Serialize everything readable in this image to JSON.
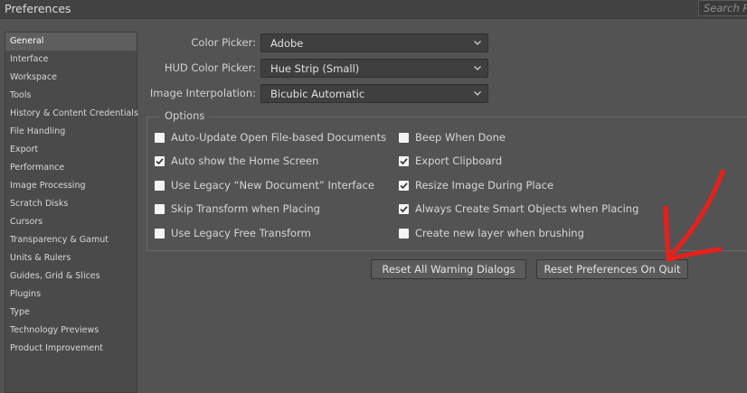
{
  "window": {
    "title": "Preferences"
  },
  "search": {
    "placeholder": "Search P"
  },
  "sidebar": {
    "items": [
      {
        "label": "General",
        "active": true
      },
      {
        "label": "Interface"
      },
      {
        "label": "Workspace"
      },
      {
        "label": "Tools"
      },
      {
        "label": "History & Content Credentials"
      },
      {
        "label": "File Handling"
      },
      {
        "label": "Export"
      },
      {
        "label": "Performance"
      },
      {
        "label": "Image Processing"
      },
      {
        "label": "Scratch Disks"
      },
      {
        "label": "Cursors"
      },
      {
        "label": "Transparency & Gamut"
      },
      {
        "label": "Units & Rulers"
      },
      {
        "label": "Guides, Grid & Slices"
      },
      {
        "label": "Plugins"
      },
      {
        "label": "Type"
      },
      {
        "label": "Technology Previews"
      },
      {
        "label": "Product Improvement"
      }
    ]
  },
  "fields": {
    "color_picker": {
      "label": "Color Picker:",
      "value": "Adobe"
    },
    "hud_color_picker": {
      "label": "HUD Color Picker:",
      "value": "Hue Strip (Small)"
    },
    "image_interpolation": {
      "label": "Image Interpolation:",
      "value": "Bicubic Automatic"
    }
  },
  "options": {
    "legend": "Options",
    "left": [
      {
        "label": "Auto-Update Open File-based Documents",
        "checked": false
      },
      {
        "label": "Auto show the Home Screen",
        "checked": true
      },
      {
        "label": "Use Legacy “New Document” Interface",
        "checked": false
      },
      {
        "label": "Skip Transform when Placing",
        "checked": false
      },
      {
        "label": "Use Legacy Free Transform",
        "checked": false
      }
    ],
    "right": [
      {
        "label": "Beep When Done",
        "checked": false
      },
      {
        "label": "Export Clipboard",
        "checked": true
      },
      {
        "label": "Resize Image During Place",
        "checked": true
      },
      {
        "label": "Always Create Smart Objects when Placing",
        "checked": true
      },
      {
        "label": "Create new layer when brushing",
        "checked": false
      }
    ]
  },
  "buttons": {
    "reset_warnings": "Reset All Warning Dialogs",
    "reset_prefs": "Reset Preferences On Quit"
  },
  "colors": {
    "panel_bg": "#535353",
    "annotation_arrow": "#e8201c"
  },
  "icons": {
    "dropdown": "chevron-down-icon",
    "check": "checkmark-icon",
    "annotation": "red-arrow-annotation"
  }
}
